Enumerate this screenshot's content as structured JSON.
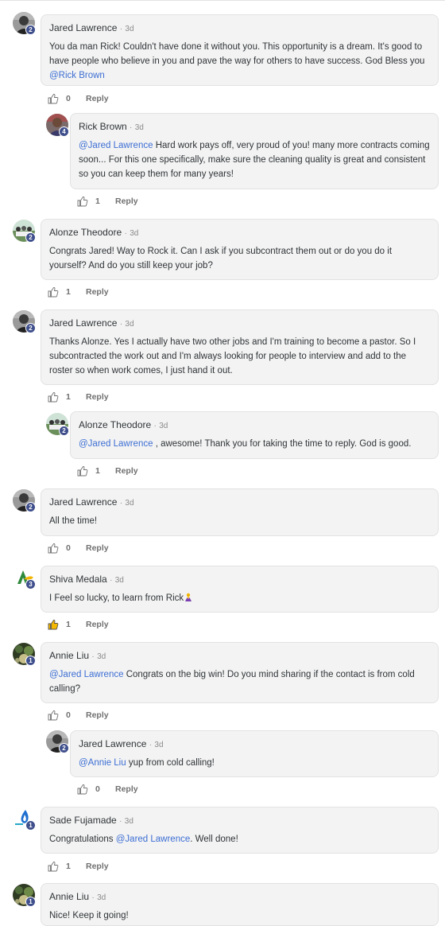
{
  "comments": [
    {
      "name": "Jared Lawrence",
      "sep": "·",
      "time": "3d",
      "badge": "2",
      "avatar": "jared",
      "text_before": "You da man Rick! Couldn't have done it without you. This opportunity is a dream. It's good to have people who believe in you and pave the way for others to have success. God Bless you ",
      "mention": "@Rick Brown",
      "text_after": "",
      "likes": "0",
      "liked": false,
      "reply_label": "Reply"
    },
    {
      "name": "Rick Brown",
      "sep": "·",
      "time": "3d",
      "badge": "4",
      "avatar": "rick",
      "text_before": "",
      "mention": "@Jared Lawrence",
      "text_after": " Hard work pays off, very proud of you! many more contracts coming soon... For this one specifically, make sure the cleaning quality is great and consistent so you can keep them for many years!",
      "likes": "1",
      "liked": false,
      "reply_label": "Reply"
    },
    {
      "name": "Alonze Theodore",
      "sep": "·",
      "time": "3d",
      "badge": "2",
      "avatar": "alonze",
      "text_before": "Congrats Jared! Way to Rock it. Can I ask if you subcontract them out or do you do it yourself? And do you still keep your job?",
      "mention": "",
      "text_after": "",
      "likes": "1",
      "liked": false,
      "reply_label": "Reply"
    },
    {
      "name": "Jared Lawrence",
      "sep": "·",
      "time": "3d",
      "badge": "2",
      "avatar": "jared",
      "text_before": "Thanks Alonze. Yes I actually have two other jobs and I'm training to become a pastor. So I subcontracted the work out and I'm always looking for people to interview and add to the roster so when work comes, I just hand it out.",
      "mention": "",
      "text_after": "",
      "likes": "1",
      "liked": false,
      "reply_label": "Reply"
    },
    {
      "name": "Alonze Theodore",
      "sep": "·",
      "time": "3d",
      "badge": "2",
      "avatar": "alonze",
      "text_before": "",
      "mention": "@Jared Lawrence",
      "text_after": " , awesome! Thank you for taking the time to reply. God is good.",
      "likes": "1",
      "liked": false,
      "reply_label": "Reply"
    },
    {
      "name": "Jared Lawrence",
      "sep": "·",
      "time": "3d",
      "badge": "2",
      "avatar": "jared",
      "text_before": "All the time!",
      "mention": "",
      "text_after": "",
      "likes": "0",
      "liked": false,
      "reply_label": "Reply"
    },
    {
      "name": "Shiva Medala",
      "sep": "·",
      "time": "3d",
      "badge": "3",
      "avatar": "shiva",
      "text_before": "I Feel so lucky, to learn from Rick",
      "mention": "",
      "text_after": "",
      "emoji": "praying-hands-emoji",
      "likes": "1",
      "liked": true,
      "reply_label": "Reply"
    },
    {
      "name": "Annie Liu",
      "sep": "·",
      "time": "3d",
      "badge": "1",
      "avatar": "annie",
      "text_before": "",
      "mention": "@Jared Lawrence",
      "text_after": " Congrats on the big win! Do you mind sharing if the contact is from cold calling?",
      "likes": "0",
      "liked": false,
      "reply_label": "Reply"
    },
    {
      "name": "Jared Lawrence",
      "sep": "·",
      "time": "3d",
      "badge": "2",
      "avatar": "jared",
      "text_before": "",
      "mention": "@Annie Liu",
      "text_after": " yup from cold calling!",
      "likes": "0",
      "liked": false,
      "reply_label": "Reply"
    },
    {
      "name": "Sade Fujamade",
      "sep": "·",
      "time": "3d",
      "badge": "1",
      "avatar": "sade",
      "text_before": "Congratulations ",
      "mention": "@Jared Lawrence",
      "text_after": ". Well done!",
      "likes": "1",
      "liked": false,
      "reply_label": "Reply"
    },
    {
      "name": "Annie Liu",
      "sep": "·",
      "time": "3d",
      "badge": "1",
      "avatar": "annie",
      "text_before": "Nice! Keep it going!",
      "mention": "",
      "text_after": "",
      "likes": "",
      "liked": false,
      "reply_label": ""
    }
  ],
  "colors": {
    "mention": "#3c6ed4",
    "badge": "#3f4f8c",
    "bubble": "#f3f3f3",
    "liked": "#f5b800"
  }
}
